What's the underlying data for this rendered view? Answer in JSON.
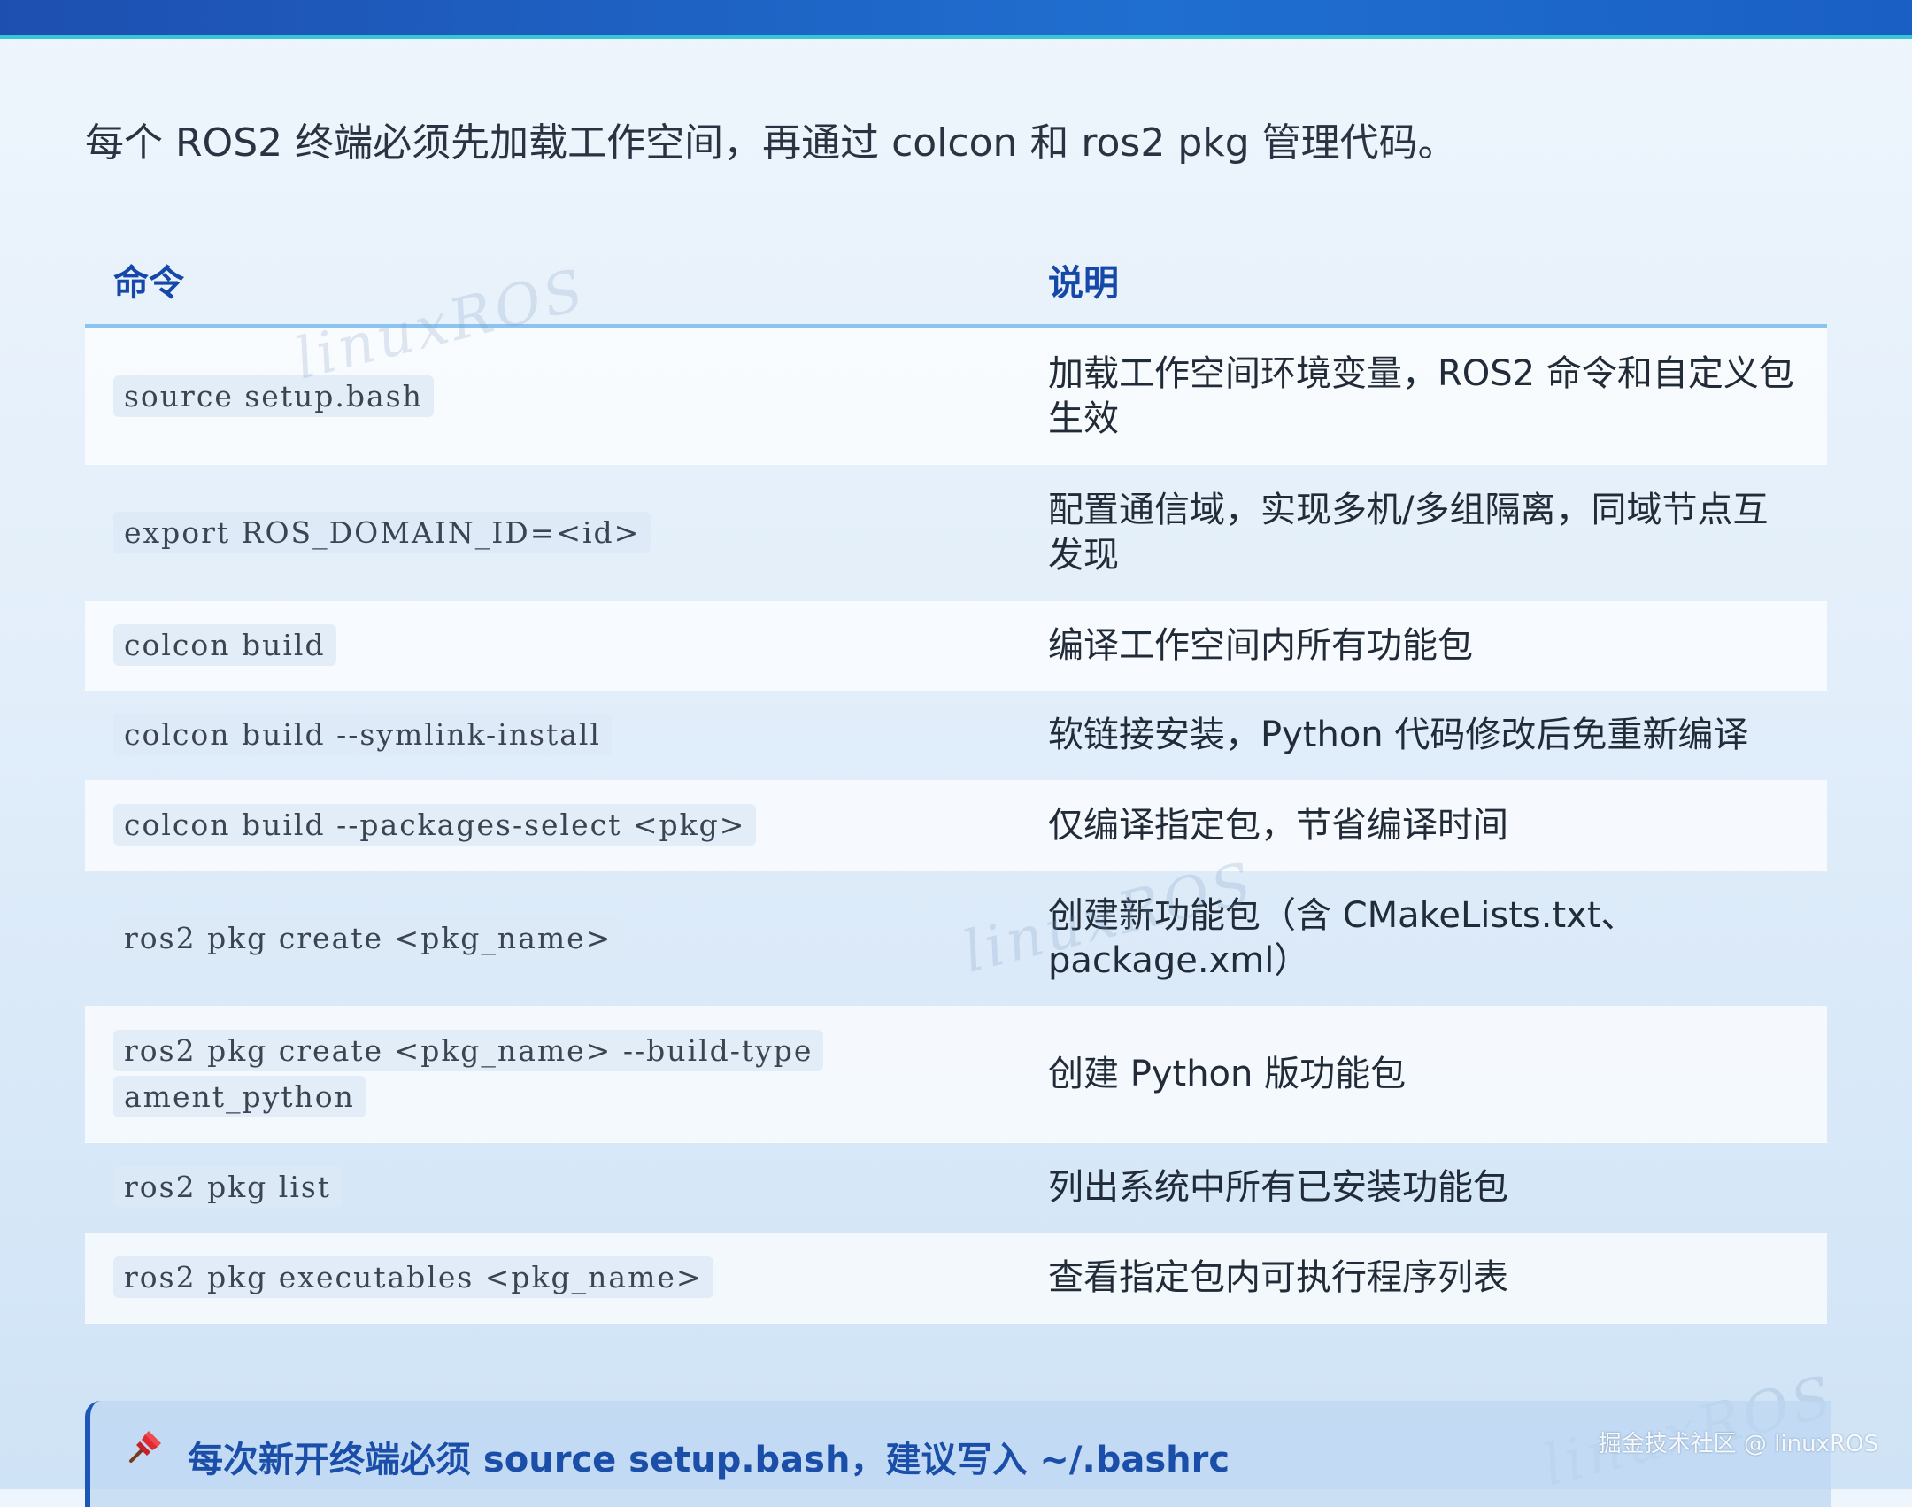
{
  "intro": "每个 ROS2 终端必须先加载工作空间，再通过 colcon 和 ros2 pkg 管理代码。",
  "table": {
    "headers": [
      "命令",
      "说明"
    ],
    "rows": [
      {
        "cmd": "source setup.bash",
        "desc": "加载工作空间环境变量，ROS2 命令和自定义包生效"
      },
      {
        "cmd": "export ROS_DOMAIN_ID=<id>",
        "desc": "配置通信域，实现多机/多组隔离，同域节点互发现"
      },
      {
        "cmd": "colcon build",
        "desc": "编译工作空间内所有功能包"
      },
      {
        "cmd": "colcon build --symlink-install",
        "desc": "软链接安装，Python 代码修改后免重新编译"
      },
      {
        "cmd": "colcon build --packages-select <pkg>",
        "desc": "仅编译指定包，节省编译时间"
      },
      {
        "cmd": "ros2 pkg create <pkg_name>",
        "desc": "创建新功能包（含 CMakeLists.txt、package.xml）"
      },
      {
        "cmd": "ros2 pkg create <pkg_name> --build-type ament_python",
        "desc": "创建 Python 版功能包"
      },
      {
        "cmd": "ros2 pkg list",
        "desc": "列出系统中所有已安装功能包"
      },
      {
        "cmd": "ros2 pkg executables <pkg_name>",
        "desc": "查看指定包内可执行程序列表"
      }
    ]
  },
  "tip": {
    "icon": "pushpin-icon",
    "text": "每次新开终端必须 source setup.bash，建议写入 ~/.bashrc"
  },
  "watermark": "linuxROS",
  "credit": "掘金技术社区 @ linuxROS",
  "colors": {
    "accent": "#1548a8",
    "top_bar": "#1d4fb0",
    "header_rule": "#8dc4ef"
  }
}
